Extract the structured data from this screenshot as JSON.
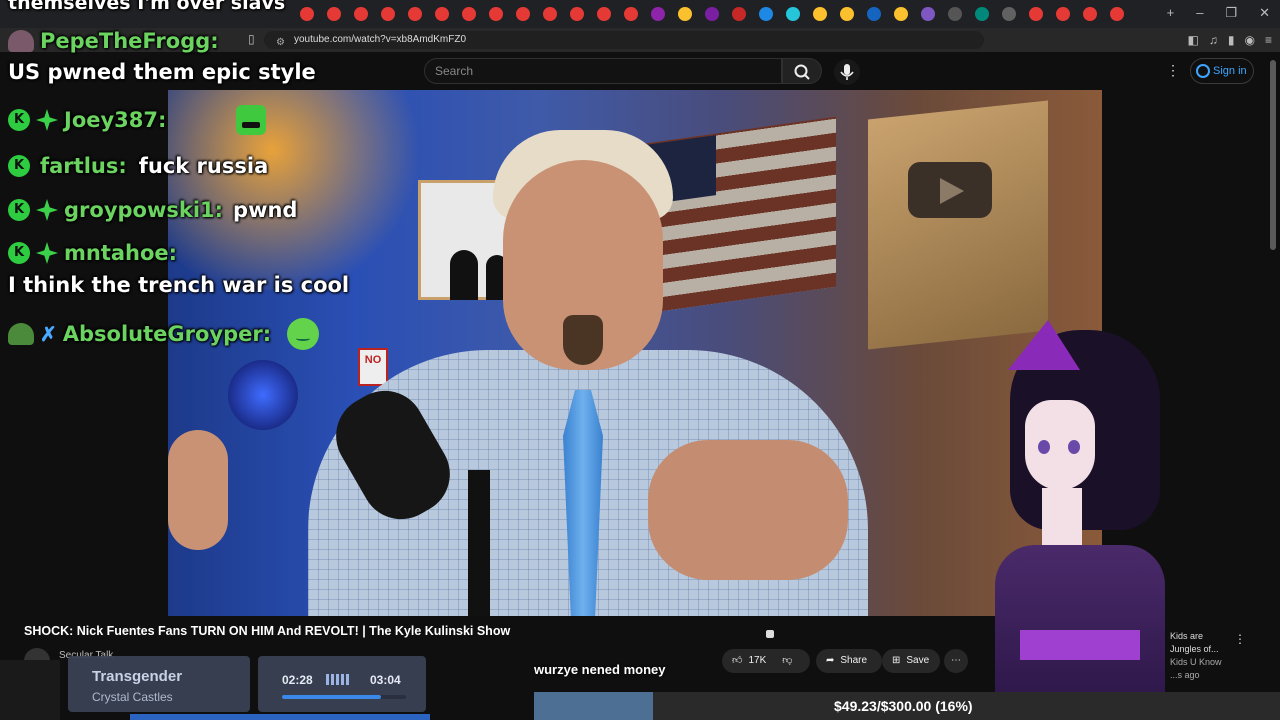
{
  "browser": {
    "url": "youtube.com/watch?v=xb8AmdKmFZ0",
    "tab_dot_colors": [
      "#e53935",
      "#e53935",
      "#e53935",
      "#e53935",
      "#e53935",
      "#e53935",
      "#e53935",
      "#e53935",
      "#e53935",
      "#e53935",
      "#e53935",
      "#e53935",
      "#e53935",
      "#8e24aa",
      "#fbc02d",
      "#7b1fa2",
      "#c62828",
      "#1e88e5",
      "#26c6da",
      "#fbc02d",
      "#fbc02d",
      "#1565c0",
      "#fbc02d",
      "#7e57c2",
      "#555555",
      "#00897b",
      "#616161",
      "#e53935",
      "#e53935",
      "#e53935",
      "#e53935"
    ]
  },
  "youtube": {
    "search_placeholder": "Search",
    "signin_label": "Sign in",
    "video_title": "SHOCK: Nick Fuentes Fans TURN ON HIM And REVOLT! | The Kyle Kulinski Show",
    "channel_name": "Secular Talk",
    "like_count": "17K",
    "share_label": "Share",
    "save_label": "Save",
    "side_rec_title": "Kids are",
    "side_rec_line2": "Jungles of...",
    "side_rec_channel": "Kids U Know",
    "side_rec_age": "...s ago"
  },
  "overlay_chat": {
    "top_cut_text": "themselves I'm over slavs",
    "messages": [
      {
        "user": "PepeTheFrogg:",
        "text": "",
        "second_line": "US pwned them epic style"
      },
      {
        "user": "Joey387:",
        "text": ""
      },
      {
        "user": "fartlus:",
        "text": "fuck russia"
      },
      {
        "user": "groypowski1:",
        "text": "pwnd"
      },
      {
        "user": "mntahoe:",
        "text": "",
        "second_line": "I think the trench war is cool"
      },
      {
        "user": "AbsoluteGroyper:",
        "text": ""
      }
    ]
  },
  "video_frame": {
    "sign_text": "NO"
  },
  "music": {
    "song_title": "Transgender",
    "artist": "Crystal Castles",
    "elapsed": "02:28",
    "duration": "03:04",
    "progress_fraction": 0.8
  },
  "caption_text": "wurzye nened money",
  "donation": {
    "label": "$49.23/$300.00 (16%)",
    "fraction": 0.16
  }
}
